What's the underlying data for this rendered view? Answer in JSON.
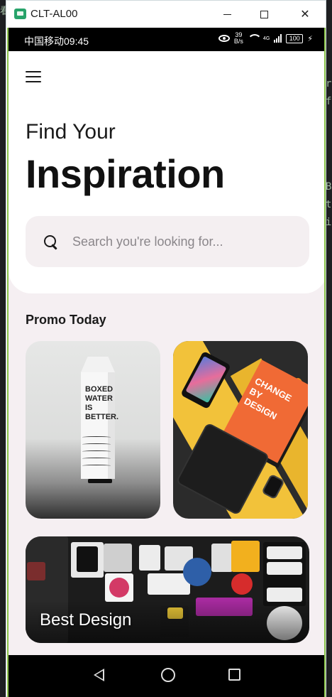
{
  "window": {
    "title": "CLT-AL00",
    "controls": {
      "minimize": "minimize-icon",
      "maximize": "maximize-icon",
      "close": "close-icon"
    }
  },
  "statusbar": {
    "carrier_time": "中国移动09:45",
    "speed_value": "39",
    "speed_unit": "B/s",
    "network": "4G",
    "battery": "100",
    "icons": [
      "eye-icon",
      "wifi-icon",
      "signal-icon",
      "battery-icon",
      "charging-icon"
    ]
  },
  "header": {
    "menu_icon": "menu-icon",
    "title_small": "Find Your",
    "title_big": "Inspiration"
  },
  "search": {
    "icon": "search-icon",
    "placeholder": "Search you're looking for...",
    "value": ""
  },
  "promo": {
    "section_title": "Promo Today",
    "cards": [
      {
        "image": "boxed water carton",
        "carton_text": "BOXED WATER IS BETTER."
      },
      {
        "image": "change by design book",
        "book_text": "CHANGE BY DESIGN"
      },
      {
        "image": "sticker collage",
        "label": "Best Design"
      }
    ]
  },
  "navbar": {
    "icons": [
      "back-icon",
      "home-icon",
      "recent-apps-icon"
    ]
  },
  "colors": {
    "app_background": "#f5eff2",
    "header_background": "#ffffff",
    "search_background": "#f4eff1",
    "accent_border": "#8bc34a",
    "promo_book": "#f06a35",
    "promo_yellow": "#f2c23a"
  }
}
